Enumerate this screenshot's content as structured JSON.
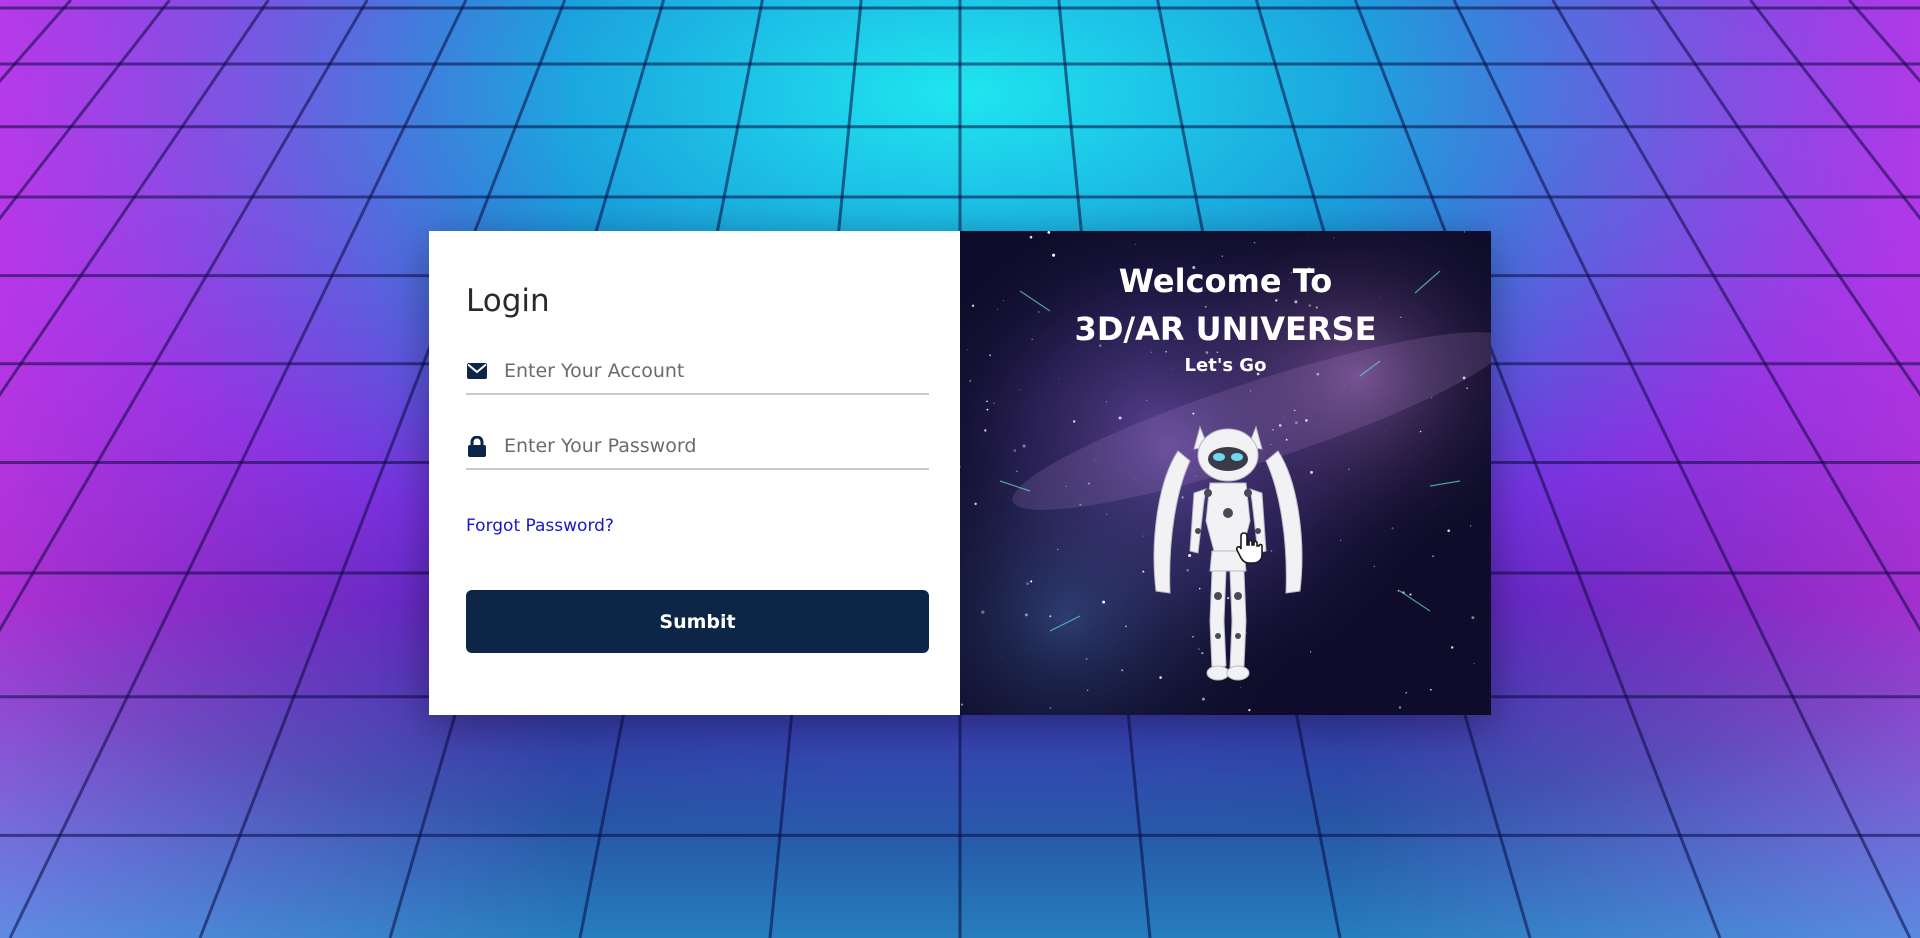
{
  "login": {
    "title": "Login",
    "account_placeholder": "Enter Your Account",
    "password_placeholder": "Enter Your Password",
    "forgot_label": "Forgot Password?",
    "submit_label": "Sumbit"
  },
  "welcome": {
    "title_line1": "Welcome To",
    "title_line2": "3D/AR UNIVERSE",
    "subtitle": "Let's Go"
  },
  "icons": {
    "account": "envelope-icon",
    "password": "lock-icon",
    "cursor": "hand-pointer-icon"
  },
  "colors": {
    "button_bg": "#0d2546",
    "link": "#1717c9",
    "card_bg": "#ffffff"
  }
}
